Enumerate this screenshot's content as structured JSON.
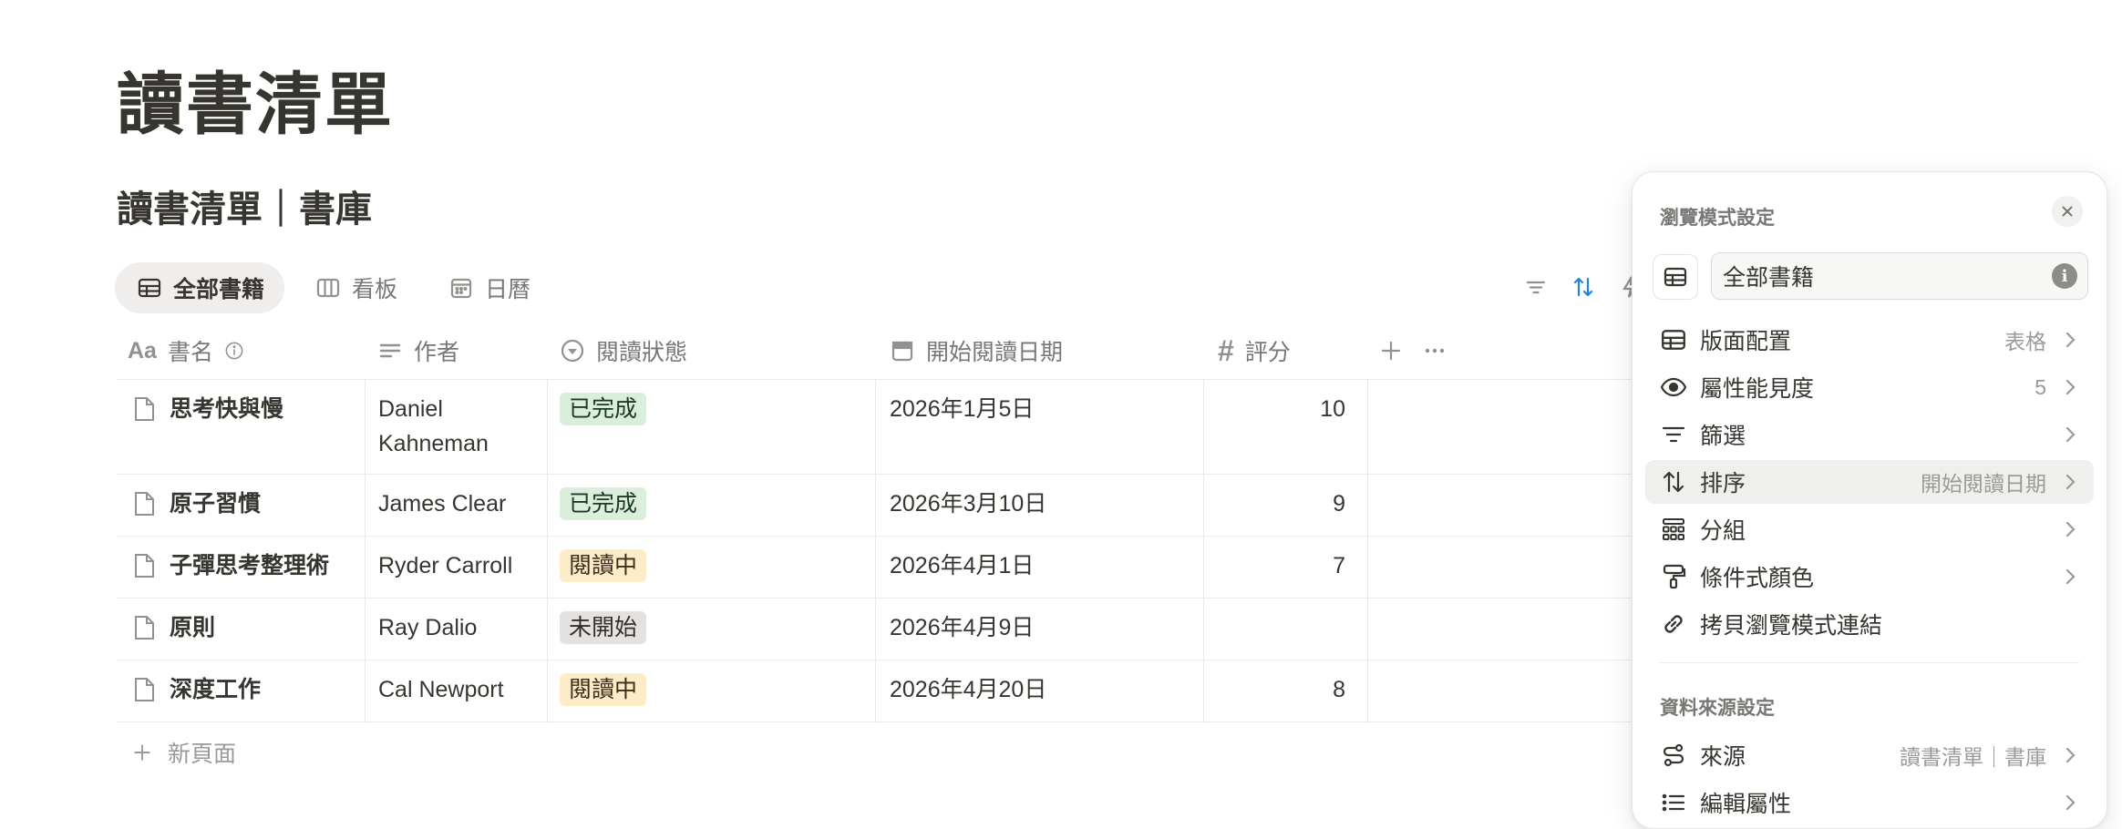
{
  "page": {
    "title": "讀書清單"
  },
  "database": {
    "title": "讀書清單｜書庫"
  },
  "views": [
    {
      "label": "全部書籍",
      "icon": "table-icon",
      "active": true
    },
    {
      "label": "看板",
      "icon": "board-icon",
      "active": false
    },
    {
      "label": "日曆",
      "icon": "calendar-icon",
      "active": false
    }
  ],
  "table": {
    "columns": [
      {
        "label": "書名",
        "icon": "text-aa-icon"
      },
      {
        "label": "作者",
        "icon": "lines-icon"
      },
      {
        "label": "閱讀狀態",
        "icon": "status-icon"
      },
      {
        "label": "開始閱讀日期",
        "icon": "calendar-icon"
      },
      {
        "label": "評分",
        "icon": "number-icon"
      }
    ],
    "rows": [
      {
        "name": "思考快與慢",
        "author_line1": "Daniel",
        "author_line2": "Kahneman",
        "status": "已完成",
        "date": "2026年1月5日",
        "rating": "10"
      },
      {
        "name": "原子習慣",
        "author_line1": "James Clear",
        "author_line2": "",
        "status": "已完成",
        "date": "2026年3月10日",
        "rating": "9"
      },
      {
        "name": "子彈思考整理術",
        "author_line1": "Ryder Carroll",
        "author_line2": "",
        "status": "閱讀中",
        "date": "2026年4月1日",
        "rating": "7"
      },
      {
        "name": "原則",
        "author_line1": "Ray Dalio",
        "author_line2": "",
        "status": "未開始",
        "date": "2026年4月9日",
        "rating": ""
      },
      {
        "name": "深度工作",
        "author_line1": "Cal Newport",
        "author_line2": "",
        "status": "閱讀中",
        "date": "2026年4月20日",
        "rating": "8"
      }
    ],
    "new_page_label": "新頁面"
  },
  "status_colors": {
    "已完成": {
      "bg": "#dbeddb",
      "fg": "#1c3829"
    },
    "閱讀中": {
      "bg": "#fdecc8",
      "fg": "#402c1b"
    },
    "未開始": {
      "bg": "#e3e2e0",
      "fg": "#32302c"
    }
  },
  "panel": {
    "header": "瀏覽模式設定",
    "view_name": "全部書籍",
    "items": [
      {
        "label": "版面配置",
        "value": "表格",
        "icon": "table-icon",
        "chevron": true
      },
      {
        "label": "屬性能見度",
        "value": "5",
        "icon": "eye-icon",
        "chevron": true
      },
      {
        "label": "篩選",
        "value": "",
        "icon": "filter-icon",
        "chevron": true
      },
      {
        "label": "排序",
        "value": "開始閱讀日期",
        "icon": "sort-icon",
        "chevron": true,
        "highlighted": true
      },
      {
        "label": "分組",
        "value": "",
        "icon": "group-icon",
        "chevron": true
      },
      {
        "label": "條件式顏色",
        "value": "",
        "icon": "paint-roller-icon",
        "chevron": true
      },
      {
        "label": "拷貝瀏覽模式連結",
        "value": "",
        "icon": "link-icon",
        "chevron": false
      }
    ],
    "source_header": "資料來源設定",
    "source_items": [
      {
        "label": "來源",
        "value": "讀書清單｜書庫",
        "icon": "source-icon",
        "chevron": true
      },
      {
        "label": "編輯屬性",
        "value": "",
        "icon": "list-icon",
        "chevron": true
      }
    ]
  }
}
